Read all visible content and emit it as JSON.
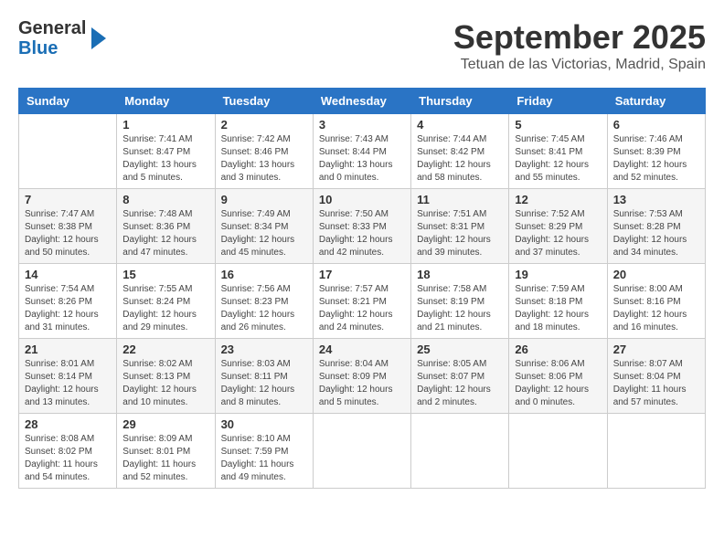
{
  "logo": {
    "line1": "General",
    "line2": "Blue"
  },
  "title": "September 2025",
  "subtitle": "Tetuan de las Victorias, Madrid, Spain",
  "weekdays": [
    "Sunday",
    "Monday",
    "Tuesday",
    "Wednesday",
    "Thursday",
    "Friday",
    "Saturday"
  ],
  "weeks": [
    [
      {
        "day": "",
        "info": ""
      },
      {
        "day": "1",
        "info": "Sunrise: 7:41 AM\nSunset: 8:47 PM\nDaylight: 13 hours\nand 5 minutes."
      },
      {
        "day": "2",
        "info": "Sunrise: 7:42 AM\nSunset: 8:46 PM\nDaylight: 13 hours\nand 3 minutes."
      },
      {
        "day": "3",
        "info": "Sunrise: 7:43 AM\nSunset: 8:44 PM\nDaylight: 13 hours\nand 0 minutes."
      },
      {
        "day": "4",
        "info": "Sunrise: 7:44 AM\nSunset: 8:42 PM\nDaylight: 12 hours\nand 58 minutes."
      },
      {
        "day": "5",
        "info": "Sunrise: 7:45 AM\nSunset: 8:41 PM\nDaylight: 12 hours\nand 55 minutes."
      },
      {
        "day": "6",
        "info": "Sunrise: 7:46 AM\nSunset: 8:39 PM\nDaylight: 12 hours\nand 52 minutes."
      }
    ],
    [
      {
        "day": "7",
        "info": "Sunrise: 7:47 AM\nSunset: 8:38 PM\nDaylight: 12 hours\nand 50 minutes."
      },
      {
        "day": "8",
        "info": "Sunrise: 7:48 AM\nSunset: 8:36 PM\nDaylight: 12 hours\nand 47 minutes."
      },
      {
        "day": "9",
        "info": "Sunrise: 7:49 AM\nSunset: 8:34 PM\nDaylight: 12 hours\nand 45 minutes."
      },
      {
        "day": "10",
        "info": "Sunrise: 7:50 AM\nSunset: 8:33 PM\nDaylight: 12 hours\nand 42 minutes."
      },
      {
        "day": "11",
        "info": "Sunrise: 7:51 AM\nSunset: 8:31 PM\nDaylight: 12 hours\nand 39 minutes."
      },
      {
        "day": "12",
        "info": "Sunrise: 7:52 AM\nSunset: 8:29 PM\nDaylight: 12 hours\nand 37 minutes."
      },
      {
        "day": "13",
        "info": "Sunrise: 7:53 AM\nSunset: 8:28 PM\nDaylight: 12 hours\nand 34 minutes."
      }
    ],
    [
      {
        "day": "14",
        "info": "Sunrise: 7:54 AM\nSunset: 8:26 PM\nDaylight: 12 hours\nand 31 minutes."
      },
      {
        "day": "15",
        "info": "Sunrise: 7:55 AM\nSunset: 8:24 PM\nDaylight: 12 hours\nand 29 minutes."
      },
      {
        "day": "16",
        "info": "Sunrise: 7:56 AM\nSunset: 8:23 PM\nDaylight: 12 hours\nand 26 minutes."
      },
      {
        "day": "17",
        "info": "Sunrise: 7:57 AM\nSunset: 8:21 PM\nDaylight: 12 hours\nand 24 minutes."
      },
      {
        "day": "18",
        "info": "Sunrise: 7:58 AM\nSunset: 8:19 PM\nDaylight: 12 hours\nand 21 minutes."
      },
      {
        "day": "19",
        "info": "Sunrise: 7:59 AM\nSunset: 8:18 PM\nDaylight: 12 hours\nand 18 minutes."
      },
      {
        "day": "20",
        "info": "Sunrise: 8:00 AM\nSunset: 8:16 PM\nDaylight: 12 hours\nand 16 minutes."
      }
    ],
    [
      {
        "day": "21",
        "info": "Sunrise: 8:01 AM\nSunset: 8:14 PM\nDaylight: 12 hours\nand 13 minutes."
      },
      {
        "day": "22",
        "info": "Sunrise: 8:02 AM\nSunset: 8:13 PM\nDaylight: 12 hours\nand 10 minutes."
      },
      {
        "day": "23",
        "info": "Sunrise: 8:03 AM\nSunset: 8:11 PM\nDaylight: 12 hours\nand 8 minutes."
      },
      {
        "day": "24",
        "info": "Sunrise: 8:04 AM\nSunset: 8:09 PM\nDaylight: 12 hours\nand 5 minutes."
      },
      {
        "day": "25",
        "info": "Sunrise: 8:05 AM\nSunset: 8:07 PM\nDaylight: 12 hours\nand 2 minutes."
      },
      {
        "day": "26",
        "info": "Sunrise: 8:06 AM\nSunset: 8:06 PM\nDaylight: 12 hours\nand 0 minutes."
      },
      {
        "day": "27",
        "info": "Sunrise: 8:07 AM\nSunset: 8:04 PM\nDaylight: 11 hours\nand 57 minutes."
      }
    ],
    [
      {
        "day": "28",
        "info": "Sunrise: 8:08 AM\nSunset: 8:02 PM\nDaylight: 11 hours\nand 54 minutes."
      },
      {
        "day": "29",
        "info": "Sunrise: 8:09 AM\nSunset: 8:01 PM\nDaylight: 11 hours\nand 52 minutes."
      },
      {
        "day": "30",
        "info": "Sunrise: 8:10 AM\nSunset: 7:59 PM\nDaylight: 11 hours\nand 49 minutes."
      },
      {
        "day": "",
        "info": ""
      },
      {
        "day": "",
        "info": ""
      },
      {
        "day": "",
        "info": ""
      },
      {
        "day": "",
        "info": ""
      }
    ]
  ]
}
